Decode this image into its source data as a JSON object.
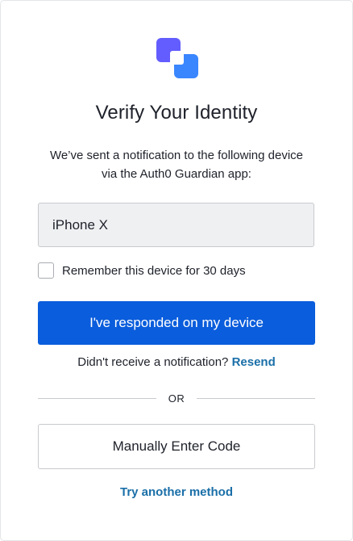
{
  "header": {
    "logo_icon": "auth0-guardian-logo-icon",
    "logo_colors": {
      "back": "#635dff",
      "front": "#3a86ff",
      "inner": "#ffffff"
    },
    "title": "Verify Your Identity",
    "description_line1": "We’ve sent a notification to the following device",
    "description_line2": "via the Auth0 Guardian app:"
  },
  "form": {
    "device_value": "iPhone X",
    "remember_label": "Remember this device for 30 days",
    "remember_checked": false,
    "primary_button_label": "I've responded on my device",
    "resend_prompt": "Didn't receive a notification?",
    "resend_link": "Resend",
    "divider_text": "OR",
    "manual_code_button_label": "Manually Enter Code",
    "try_another_link": "Try another method"
  },
  "colors": {
    "primary": "#0a5ddc",
    "link": "#1a6fa8",
    "field_background": "#eff0f2"
  }
}
